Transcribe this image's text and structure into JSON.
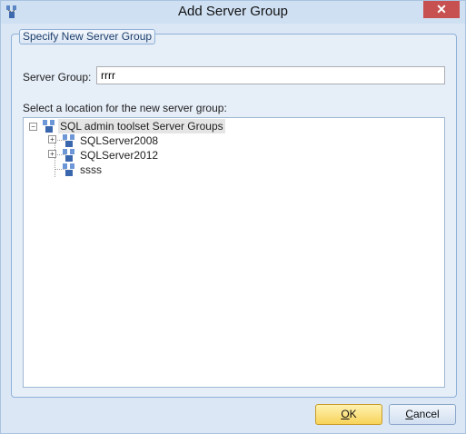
{
  "window": {
    "title": "Add Server Group",
    "close_glyph": "✕"
  },
  "group": {
    "title": "Specify New Server Group",
    "server_group_label": "Server Group:",
    "server_group_value": "rrrr",
    "location_label": "Select a location for the new server group:"
  },
  "tree": {
    "root": {
      "label": "SQL admin toolset Server Groups",
      "expanded": true,
      "icon": "server-group-icon"
    },
    "children": [
      {
        "label": "SQLServer2008",
        "has_children": true,
        "expanded": false,
        "icon": "server-group-icon"
      },
      {
        "label": "SQLServer2012",
        "has_children": true,
        "expanded": false,
        "icon": "server-group-icon"
      },
      {
        "label": "ssss",
        "has_children": false,
        "icon": "server-group-icon"
      }
    ]
  },
  "buttons": {
    "ok_mnemonic": "O",
    "ok_rest": "K",
    "cancel_mnemonic": "C",
    "cancel_rest": "ancel"
  },
  "colors": {
    "ok_button": "#f7d35a",
    "accent_border": "#8fb1d8",
    "close": "#c75050"
  }
}
